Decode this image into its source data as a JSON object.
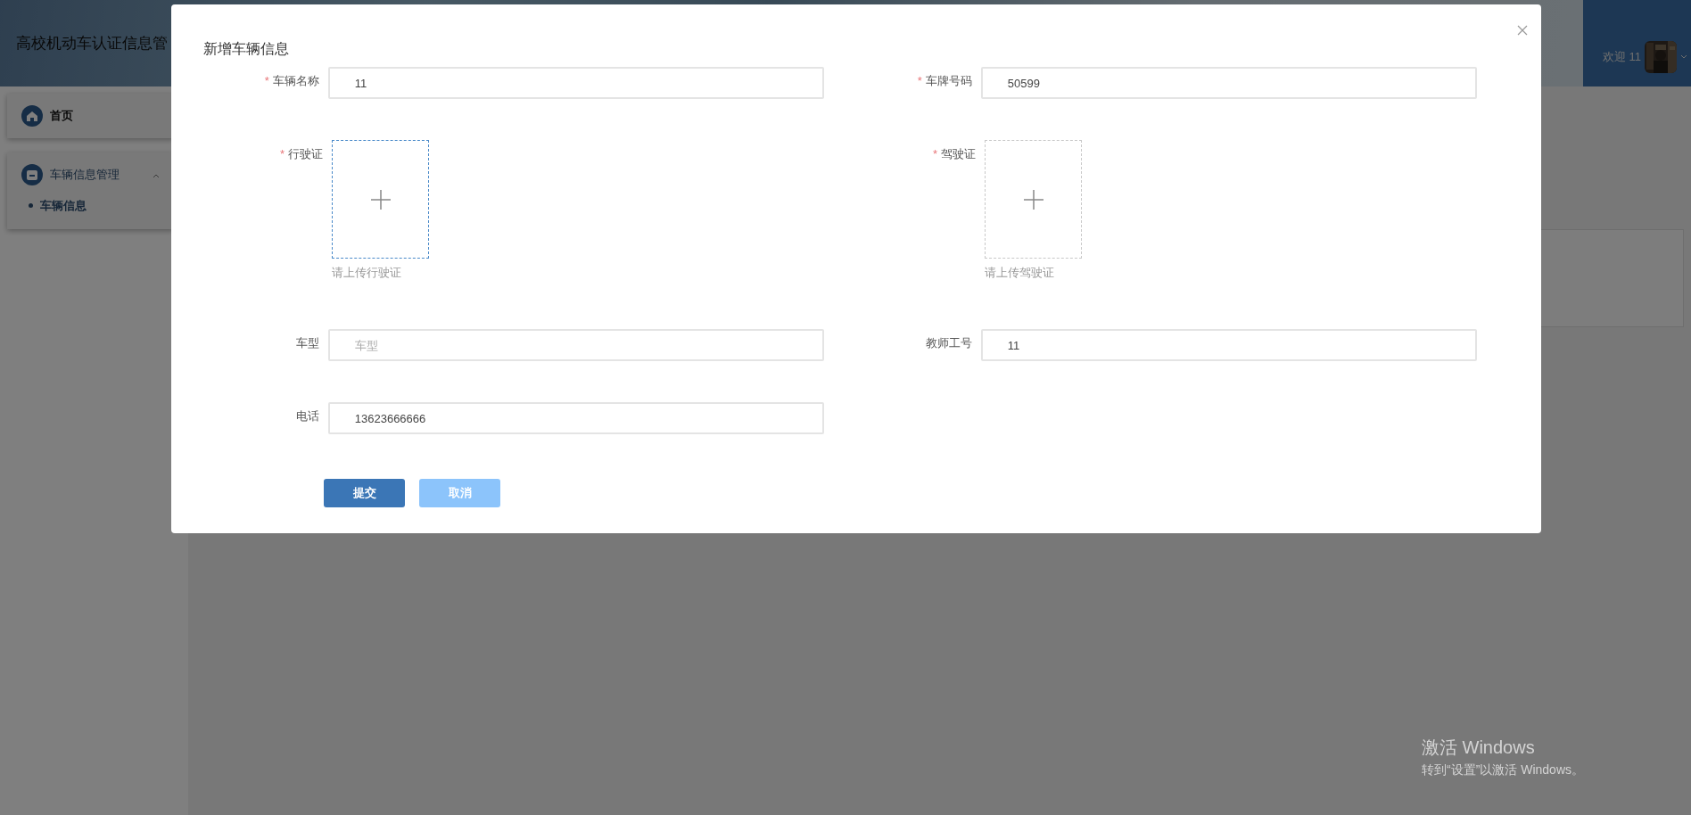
{
  "header": {
    "title": "高校机动车认证信息管",
    "welcome": "欢迎 11"
  },
  "sidebar": {
    "items": [
      {
        "kind": "link",
        "label": "首页"
      },
      {
        "kind": "group",
        "label": "车辆信息管理",
        "expanded": true,
        "children": [
          {
            "label": "车辆信息"
          }
        ]
      }
    ]
  },
  "dialog": {
    "title": "新增车辆信息",
    "fields": [
      {
        "kind": "input",
        "marker": "*",
        "label": "车辆名称",
        "value": "11"
      },
      {
        "kind": "input",
        "marker": "*",
        "label": "车牌号码",
        "value": "50599"
      },
      {
        "kind": "upload",
        "marker": "*",
        "label": "行驶证",
        "hint": "请上传行驶证",
        "focused": true
      },
      {
        "kind": "upload",
        "marker": "*",
        "label": "驾驶证",
        "hint": "请上传驾驶证",
        "focused": false
      },
      {
        "kind": "input",
        "label": "车型",
        "placeholder": "车型"
      },
      {
        "kind": "input",
        "label": "教师工号",
        "value": "11"
      },
      {
        "kind": "input",
        "label": "电话",
        "value": "13623666666"
      }
    ],
    "buttons": [
      {
        "label": "提交",
        "kind": "primary"
      },
      {
        "label": "取消",
        "kind": "light"
      }
    ]
  },
  "os_notice": {
    "title": "激活 Windows",
    "text": "转到“设置”以激活 Windows。"
  }
}
